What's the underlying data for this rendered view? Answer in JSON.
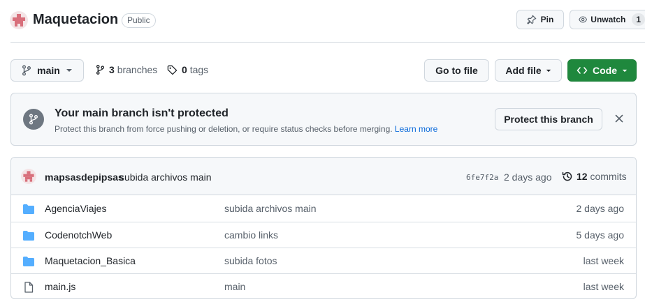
{
  "repo": {
    "name": "Maquetacion",
    "visibility": "Public",
    "actions": {
      "pin_label": "Pin",
      "unwatch_label": "Unwatch",
      "watch_count": "1"
    }
  },
  "toolbar": {
    "branch": "main",
    "branches_count": "3",
    "branches_label": "branches",
    "tags_count": "0",
    "tags_label": "tags",
    "go_to_file_label": "Go to file",
    "add_file_label": "Add file",
    "code_label": "Code"
  },
  "protection_banner": {
    "title": "Your main branch isn't protected",
    "description": "Protect this branch from force pushing or deletion, or require status checks before merging.",
    "link": "Learn more",
    "button_label": "Protect this branch"
  },
  "latest_commit": {
    "author": "mapsasdepipsas",
    "message": "subida archivos main",
    "sha": "6fe7f2a",
    "time": "2 days ago",
    "commit_count": "12",
    "commit_label": "commits"
  },
  "files": [
    {
      "type": "folder",
      "name": "AgenciaViajes",
      "message": "subida archivos main",
      "age": "2 days ago"
    },
    {
      "type": "folder",
      "name": "CodenotchWeb",
      "message": "cambio links",
      "age": "5 days ago"
    },
    {
      "type": "folder",
      "name": "Maquetacion_Basica",
      "message": "subida fotos",
      "age": "last week"
    },
    {
      "type": "file",
      "name": "main.js",
      "message": "main",
      "age": "last week"
    }
  ],
  "colors": {
    "accent_blue": "#0969da",
    "folder_blue": "#54aeff",
    "code_green": "#1f883d",
    "avatar_red": "#d86f7b"
  }
}
